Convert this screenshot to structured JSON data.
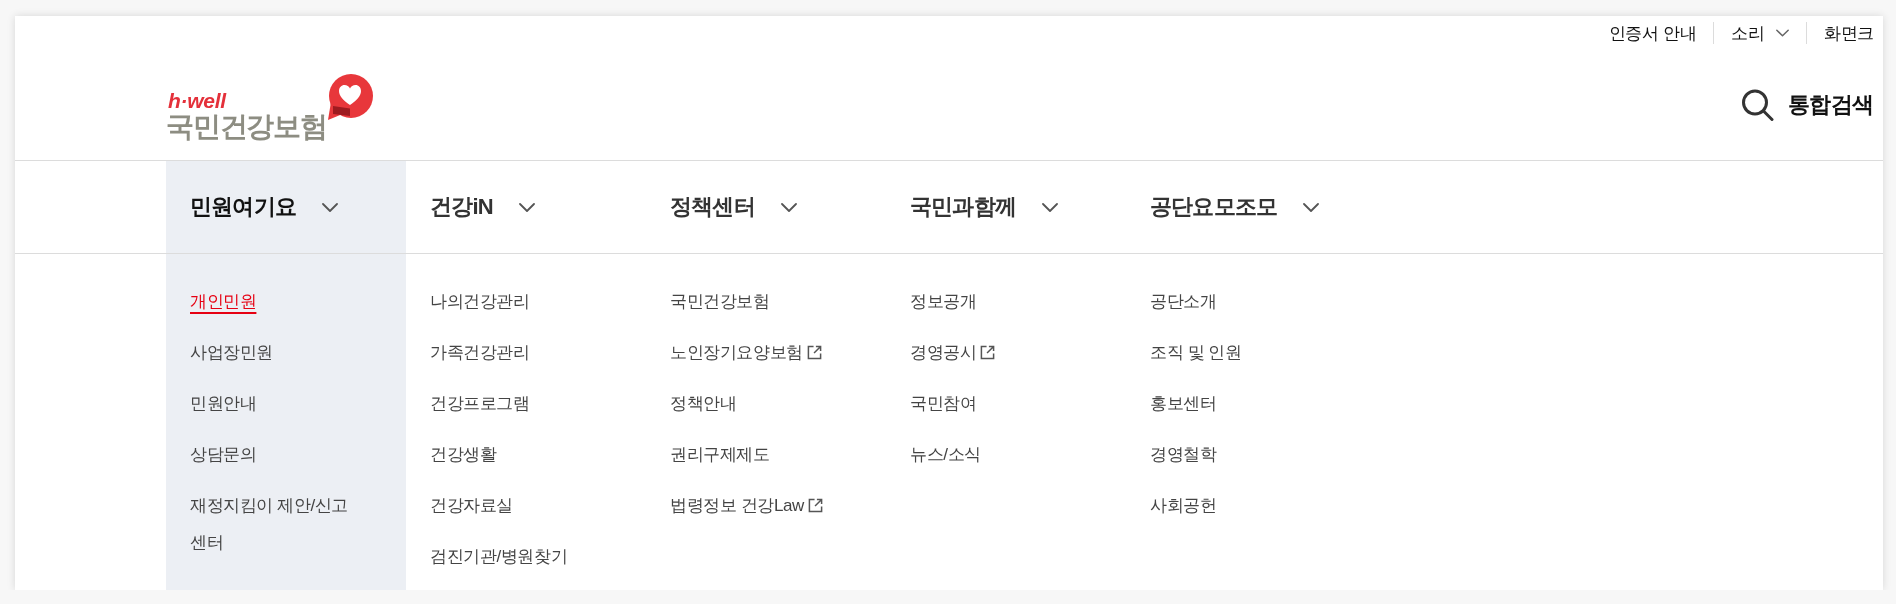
{
  "utility_links": [
    {
      "label": "인증서 안내",
      "dropdown": false
    },
    {
      "label": "소리",
      "dropdown": true
    },
    {
      "label": "화면크",
      "dropdown": false
    }
  ],
  "logo": {
    "tagline": "h·well",
    "name": "국민건강보험"
  },
  "search": {
    "label": "통합검색"
  },
  "nav": [
    {
      "label": "민원여기요",
      "selected": true,
      "items": [
        {
          "label": "개인민원",
          "selected": true,
          "external": false
        },
        {
          "label": "사업장민원",
          "selected": false,
          "external": false
        },
        {
          "label": "민원안내",
          "selected": false,
          "external": false
        },
        {
          "label": "상담문의",
          "selected": false,
          "external": false
        },
        {
          "label": "재정지킴이 제안/신고 센터",
          "selected": false,
          "external": false
        }
      ]
    },
    {
      "label": "건강iN",
      "selected": false,
      "items": [
        {
          "label": "나의건강관리",
          "selected": false,
          "external": false
        },
        {
          "label": "가족건강관리",
          "selected": false,
          "external": false
        },
        {
          "label": "건강프로그램",
          "selected": false,
          "external": false
        },
        {
          "label": "건강생활",
          "selected": false,
          "external": false
        },
        {
          "label": "건강자료실",
          "selected": false,
          "external": false
        },
        {
          "label": "검진기관/병원찾기",
          "selected": false,
          "external": false
        }
      ]
    },
    {
      "label": "정책센터",
      "selected": false,
      "items": [
        {
          "label": "국민건강보험",
          "selected": false,
          "external": false
        },
        {
          "label": "노인장기요양보험",
          "selected": false,
          "external": true
        },
        {
          "label": "정책안내",
          "selected": false,
          "external": false
        },
        {
          "label": "권리구제제도",
          "selected": false,
          "external": false
        },
        {
          "label": "법령정보 건강Law",
          "selected": false,
          "external": true
        }
      ]
    },
    {
      "label": "국민과함께",
      "selected": false,
      "items": [
        {
          "label": "정보공개",
          "selected": false,
          "external": false
        },
        {
          "label": "경영공시",
          "selected": false,
          "external": true
        },
        {
          "label": "국민참여",
          "selected": false,
          "external": false
        },
        {
          "label": "뉴스/소식",
          "selected": false,
          "external": false
        }
      ]
    },
    {
      "label": "공단요모조모",
      "selected": false,
      "items": [
        {
          "label": "공단소개",
          "selected": false,
          "external": false
        },
        {
          "label": "조직 및 인원",
          "selected": false,
          "external": false
        },
        {
          "label": "홍보센터",
          "selected": false,
          "external": false
        },
        {
          "label": "경영철학",
          "selected": false,
          "external": false
        },
        {
          "label": "사회공헌",
          "selected": false,
          "external": false
        }
      ]
    }
  ]
}
